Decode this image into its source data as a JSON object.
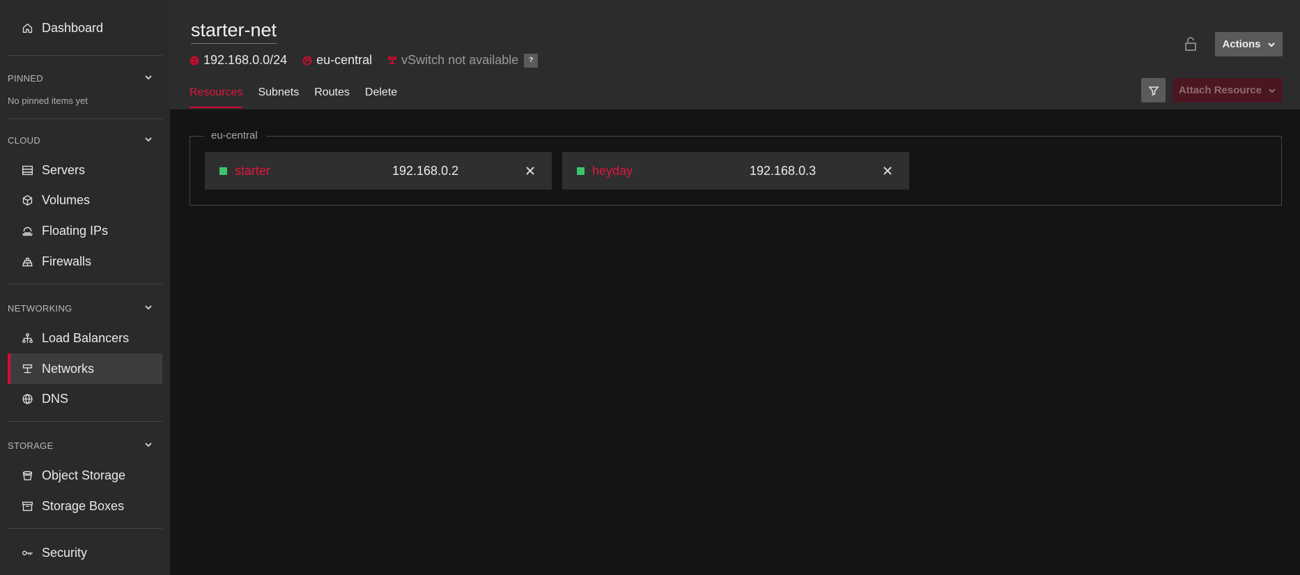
{
  "sidebar": {
    "dashboard": "Dashboard",
    "pinned": {
      "title": "PINNED",
      "empty": "No pinned items yet"
    },
    "cloud": {
      "title": "CLOUD",
      "items": [
        "Servers",
        "Volumes",
        "Floating IPs",
        "Firewalls"
      ]
    },
    "networking": {
      "title": "NETWORKING",
      "items": [
        "Load Balancers",
        "Networks",
        "DNS"
      ]
    },
    "storage": {
      "title": "STORAGE",
      "items": [
        "Object Storage",
        "Storage Boxes"
      ]
    },
    "security": "Security",
    "active_item": "Networks"
  },
  "header": {
    "title": "starter-net",
    "ip_range": "192.168.0.0/24",
    "zone": "eu-central",
    "vswitch": "vSwitch not available",
    "help": "?",
    "tabs": [
      "Resources",
      "Subnets",
      "Routes",
      "Delete"
    ],
    "active_tab": "Resources",
    "actions_label": "Actions",
    "attach_label": "Attach Resource"
  },
  "region": {
    "name": "eu-central",
    "resources": [
      {
        "name": "starter",
        "ip": "192.168.0.2",
        "status": "running"
      },
      {
        "name": "heyday",
        "ip": "192.168.0.3",
        "status": "running"
      }
    ]
  },
  "colors": {
    "accent": "#d50c2d",
    "status_running": "#3ec46d",
    "sidebar_bg": "#2a2a2a",
    "main_bg": "#141414"
  }
}
